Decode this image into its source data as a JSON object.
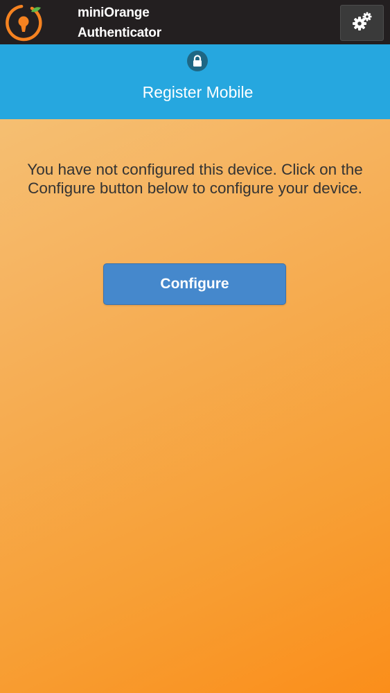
{
  "app": {
    "title_line1": "miniOrange",
    "title_line2": "Authenticator"
  },
  "header": {
    "title": "Register Mobile"
  },
  "main": {
    "message": "You have not configured this device. Click on the Configure button below to configure your device.",
    "configure_label": "Configure"
  },
  "icons": {
    "logo": "miniorange-logo-icon",
    "settings": "gears-icon",
    "lock": "lock-icon"
  },
  "colors": {
    "topbar": "#231f20",
    "header": "#26a7df",
    "button": "#4588cc",
    "brand_orange": "#f58220",
    "leaf_green": "#5db848"
  }
}
